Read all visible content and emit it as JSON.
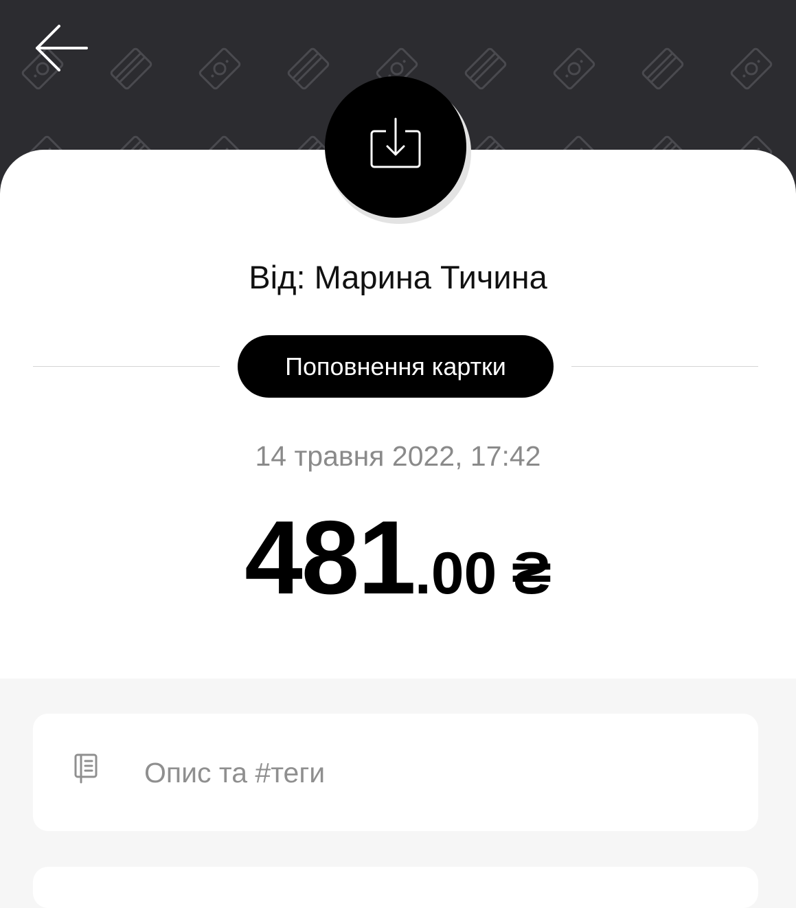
{
  "header": {
    "background_color": "#2c2c30",
    "pattern_icons": [
      "money-icon",
      "card-icon"
    ]
  },
  "transaction": {
    "icon": "download-icon",
    "sender": "Від: Марина Тичина",
    "category": "Поповнення картки",
    "datetime": "14 травня 2022, 17:42",
    "amount_int": "481",
    "amount_frac": ".00",
    "currency": "₴"
  },
  "description": {
    "icon": "note-icon",
    "placeholder": "Опис та #теги"
  }
}
